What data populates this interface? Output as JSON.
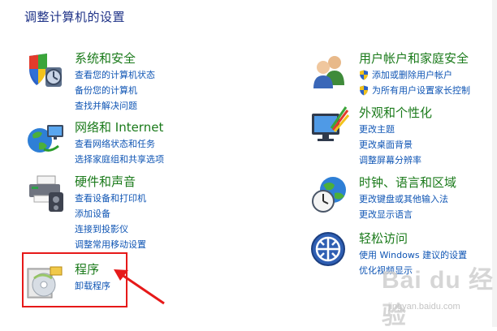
{
  "page": {
    "title": "调整计算机的设置"
  },
  "left_categories": [
    {
      "title": "系统和安全",
      "icon": "system-security-icon",
      "links": [
        {
          "label": "查看您的计算机状态"
        },
        {
          "label": "备份您的计算机"
        },
        {
          "label": "查找并解决问题"
        }
      ]
    },
    {
      "title": "网络和 Internet",
      "icon": "network-internet-icon",
      "links": [
        {
          "label": "查看网络状态和任务"
        },
        {
          "label": "选择家庭组和共享选项"
        }
      ]
    },
    {
      "title": "硬件和声音",
      "icon": "hardware-sound-icon",
      "links": [
        {
          "label": "查看设备和打印机"
        },
        {
          "label": "添加设备"
        },
        {
          "label": "连接到投影仪"
        },
        {
          "label": "调整常用移动设置"
        }
      ]
    },
    {
      "title": "程序",
      "icon": "programs-icon",
      "links": [
        {
          "label": "卸载程序"
        }
      ]
    }
  ],
  "right_categories": [
    {
      "title": "用户帐户和家庭安全",
      "icon": "user-accounts-icon",
      "links": [
        {
          "label": "添加或删除用户帐户",
          "shield": true
        },
        {
          "label": "为所有用户设置家长控制",
          "shield": true
        }
      ]
    },
    {
      "title": "外观和个性化",
      "icon": "appearance-icon",
      "links": [
        {
          "label": "更改主题"
        },
        {
          "label": "更改桌面背景"
        },
        {
          "label": "调整屏幕分辨率"
        }
      ]
    },
    {
      "title": "时钟、语言和区域",
      "icon": "clock-language-region-icon",
      "links": [
        {
          "label": "更改键盘或其他输入法"
        },
        {
          "label": "更改显示语言"
        }
      ]
    },
    {
      "title": "轻松访问",
      "icon": "ease-of-access-icon",
      "links": [
        {
          "label": "使用 Windows 建议的设置"
        },
        {
          "label": "优化视频显示"
        }
      ]
    }
  ],
  "watermark": {
    "text": "Bai du 经验",
    "url": "jingyan.baidu.com"
  },
  "colors": {
    "title": "#1a7a1a",
    "link": "#0f55b4",
    "heading": "#1e3287",
    "annotation": "#e61919"
  }
}
